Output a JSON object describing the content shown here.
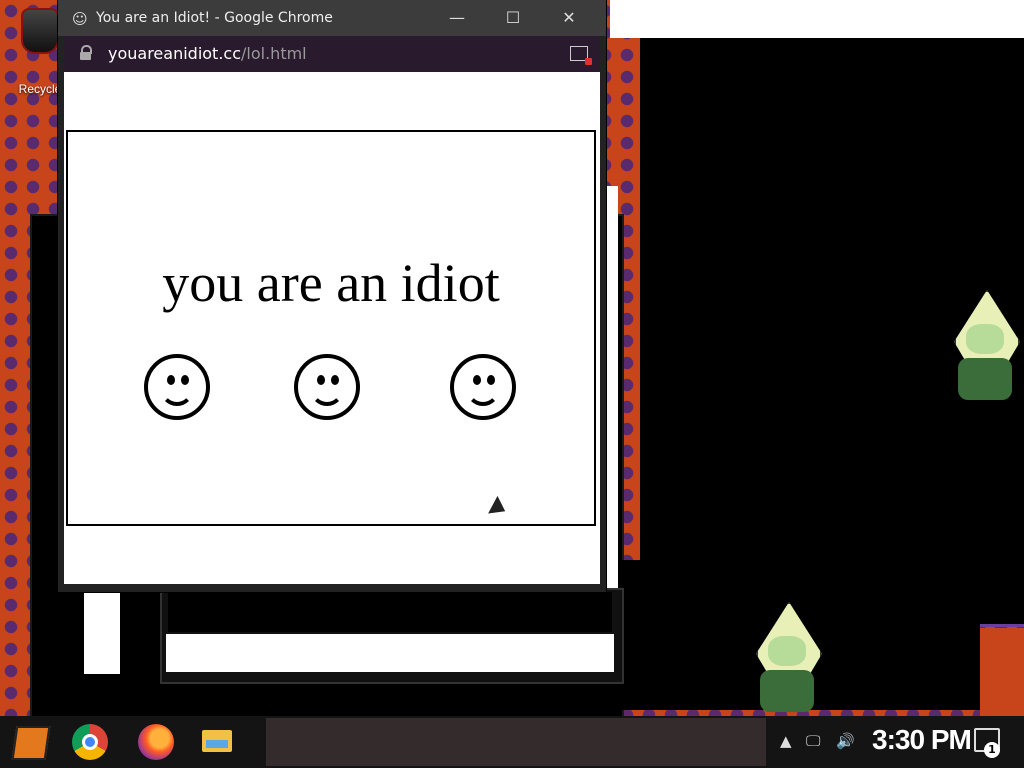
{
  "desktop": {
    "recycle_bin_label": "Recycle"
  },
  "browser": {
    "title": "You are an Idiot! - Google Chrome",
    "title_icon": "☺",
    "minimize": "—",
    "maximize": "☐",
    "close": "✕",
    "url_host": "youareanidiot.cc",
    "url_path": "/lol.html"
  },
  "page": {
    "headline": "you are an idiot",
    "smiley_count": 3
  },
  "taskbar": {
    "tray_chevron": "▲",
    "network_icon": "🖵",
    "volume_icon": "🔊",
    "clock": "3:30 PM",
    "notification_count": "1"
  }
}
